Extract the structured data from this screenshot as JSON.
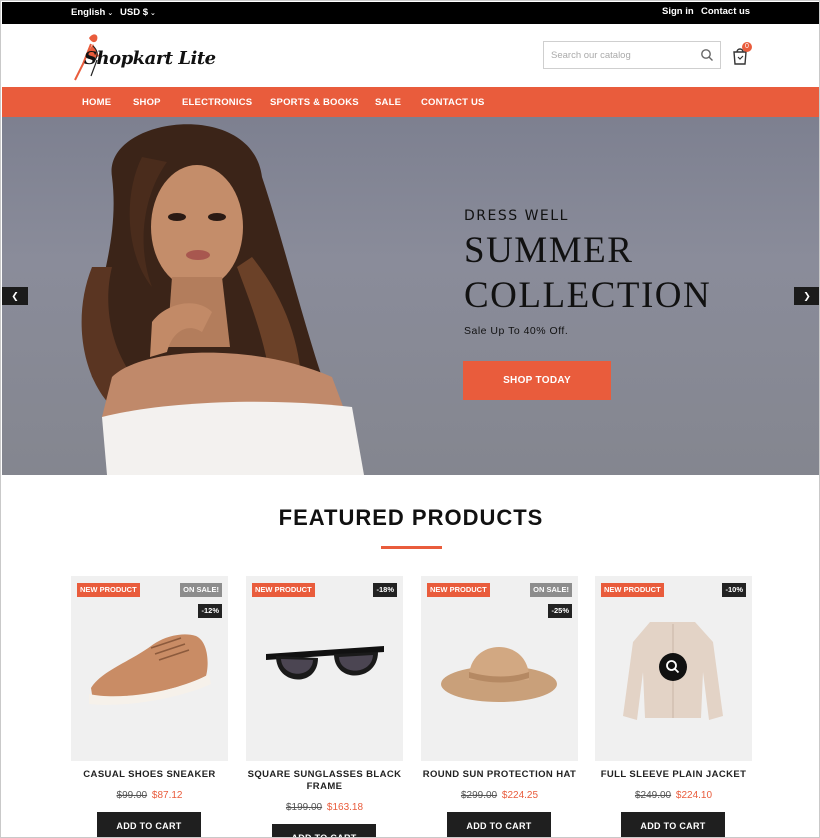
{
  "topbar": {
    "language": "English",
    "currency": "USD $",
    "sign_in": "Sign in",
    "contact": "Contact us"
  },
  "header": {
    "logo_text": "Shopkart Lite",
    "search_placeholder": "Search our catalog",
    "cart_count": "0"
  },
  "nav": {
    "items": [
      "HOME",
      "SHOP",
      "ELECTRONICS",
      "SPORTS & BOOKS",
      "SALE",
      "CONTACT US"
    ]
  },
  "hero": {
    "subtitle": "DRESS WELL",
    "title_line1": "SUMMER",
    "title_line2": "COLLECTION",
    "tagline": "Sale Up To 40% Off.",
    "button": "SHOP TODAY",
    "prev_arrow": "❮",
    "next_arrow": "❯"
  },
  "featured": {
    "title": "FEATURED PRODUCTS",
    "new_badge": "NEW PRODUCT",
    "sale_badge": "ON SALE!",
    "add_to_cart": "ADD TO CART",
    "products": [
      {
        "name": "CASUAL SHOES SNEAKER",
        "old_price": "$99.00",
        "price": "$87.12",
        "discount": "-12%",
        "on_sale": true
      },
      {
        "name": "SQUARE SUNGLASSES BLACK FRAME",
        "old_price": "$199.00",
        "price": "$163.18",
        "discount": "-18%",
        "on_sale": false
      },
      {
        "name": "ROUND SUN PROTECTION HAT",
        "old_price": "$299.00",
        "price": "$224.25",
        "discount": "-25%",
        "on_sale": true
      },
      {
        "name": "FULL SLEEVE PLAIN JACKET",
        "old_price": "$249.00",
        "price": "$224.10",
        "discount": "-10%",
        "on_sale": false
      }
    ]
  },
  "colors": {
    "accent": "#e95c3c",
    "topbar": "#000000",
    "button_dark": "#1f1f1f"
  }
}
